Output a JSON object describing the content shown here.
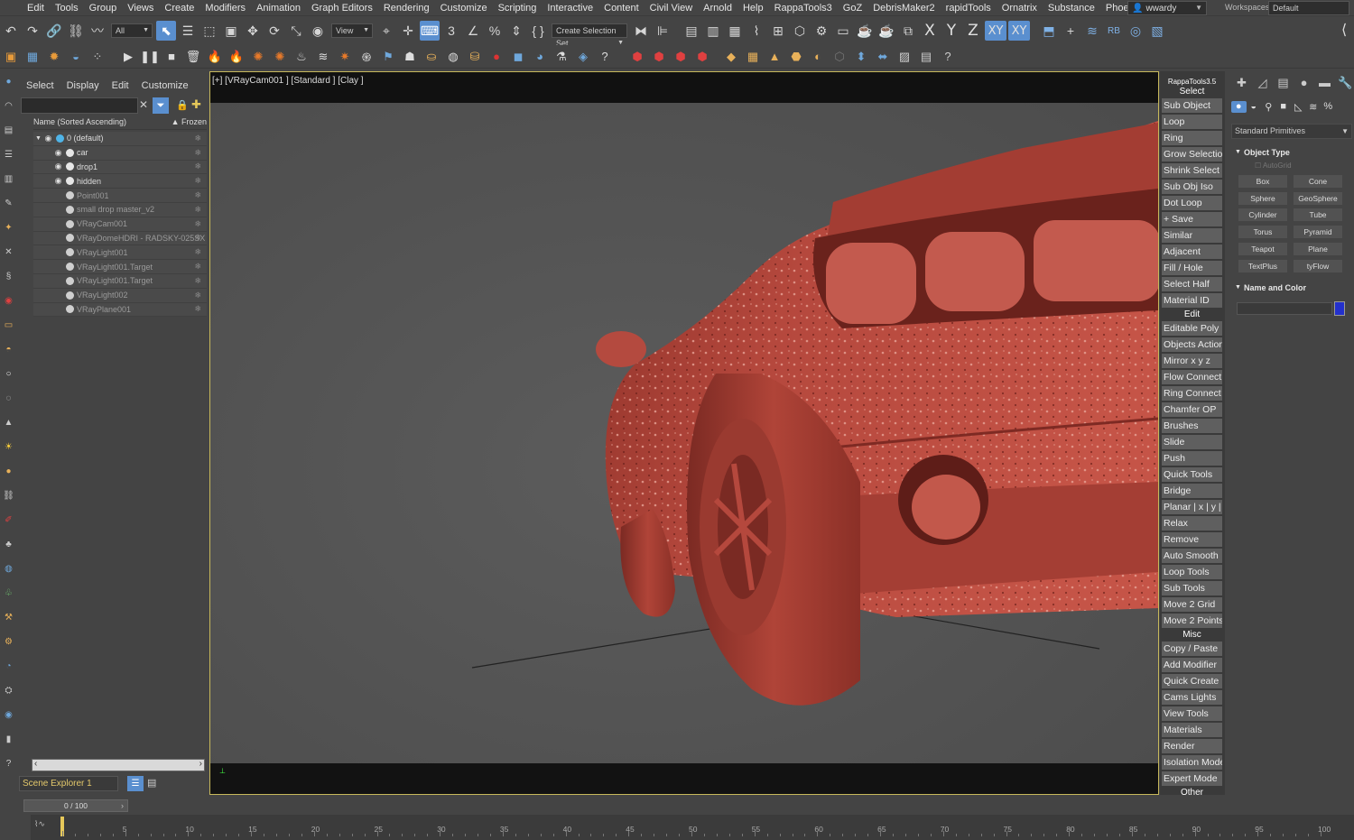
{
  "menu": [
    "Edit",
    "Tools",
    "Group",
    "Views",
    "Create",
    "Modifiers",
    "Animation",
    "Graph Editors",
    "Rendering",
    "Customize",
    "Scripting",
    "Interactive",
    "Content",
    "Civil View",
    "Arnold",
    "Help",
    "RappaTools3",
    "GoZ",
    "DebrisMaker2",
    "rapidTools",
    "Ornatrix",
    "Substance",
    "Phoenix FD"
  ],
  "user": "wwardy",
  "workspaces_label": "Workspaces:",
  "workspace_value": "Default",
  "toolbar": {
    "filter_value": "All",
    "ref_coord_value": "View",
    "selection_set": "Create Selection Set",
    "axis_x": "X",
    "axis_y": "Y",
    "axis_z": "Z",
    "axis_xy": "XY",
    "axis_xy2": "XY"
  },
  "scene_explorer": {
    "menu": [
      "Select",
      "Display",
      "Edit",
      "Customize"
    ],
    "col_name": "Name (Sorted Ascending)",
    "col_frozen": "▲ Frozen",
    "rows": [
      {
        "name": "0 (default)",
        "dim": false
      },
      {
        "name": "car",
        "dim": false
      },
      {
        "name": "drop1",
        "dim": false
      },
      {
        "name": "hidden",
        "dim": false
      },
      {
        "name": "Point001",
        "dim": true
      },
      {
        "name": "small drop master_v2",
        "dim": true
      },
      {
        "name": "VRayCam001",
        "dim": true
      },
      {
        "name": "VRayDomeHDRI - RADSKY-025SX",
        "dim": true
      },
      {
        "name": "VRayLight001",
        "dim": true
      },
      {
        "name": "VRayLight001.Target",
        "dim": true
      },
      {
        "name": "VRayLight001.Target",
        "dim": true
      },
      {
        "name": "VRayLight002",
        "dim": true
      },
      {
        "name": "VRayPlane001",
        "dim": true
      }
    ],
    "explorer_name": "Scene Explorer 1"
  },
  "viewport": {
    "label": "[+] [VRayCam001 ] [Standard ] [Clay ]"
  },
  "rappatools": {
    "title": "RappaTools3.5",
    "items": [
      {
        "label": "Select",
        "head": true
      },
      {
        "label": "Sub Object"
      },
      {
        "label": "Loop"
      },
      {
        "label": "Ring"
      },
      {
        "label": "Grow Selection"
      },
      {
        "label": "Shrink Select"
      },
      {
        "label": "Sub Obj Iso"
      },
      {
        "label": "Dot Loop"
      },
      {
        "label": "+ Save"
      },
      {
        "label": "Similar"
      },
      {
        "label": "Adjacent"
      },
      {
        "label": "Fill / Hole"
      },
      {
        "label": "Select Half"
      },
      {
        "label": "Material ID"
      },
      {
        "label": "Edit",
        "head": true
      },
      {
        "label": "Editable Poly"
      },
      {
        "label": "Objects Actions"
      },
      {
        "label": "Mirror   x  y  z"
      },
      {
        "label": "Flow Connect"
      },
      {
        "label": "Ring Connect"
      },
      {
        "label": "Chamfer OP"
      },
      {
        "label": "Brushes"
      },
      {
        "label": "Slide"
      },
      {
        "label": "Push"
      },
      {
        "label": "Quick Tools"
      },
      {
        "label": "Bridge"
      },
      {
        "label": "Planar | x | y | z"
      },
      {
        "label": "Relax"
      },
      {
        "label": "Remove"
      },
      {
        "label": "Auto Smooth"
      },
      {
        "label": "Loop Tools"
      },
      {
        "label": "Sub Tools"
      },
      {
        "label": "Move 2 Grid"
      },
      {
        "label": "Move 2 Points"
      },
      {
        "label": "Misc",
        "head": true
      },
      {
        "label": "Copy / Paste"
      },
      {
        "label": "Add Modifier"
      },
      {
        "label": "Quick Create"
      },
      {
        "label": "Cams Lights"
      },
      {
        "label": "View Tools"
      },
      {
        "label": "Materials"
      },
      {
        "label": "Render"
      },
      {
        "label": "Isolation Mode"
      },
      {
        "label": "Expert Mode"
      },
      {
        "label": "Other",
        "head": true
      }
    ]
  },
  "command_panel": {
    "primitive_type": "Standard Primitives",
    "object_type_title": "Object Type",
    "autogrid": "AutoGrid",
    "object_buttons": [
      "Box",
      "Cone",
      "Sphere",
      "GeoSphere",
      "Cylinder",
      "Tube",
      "Torus",
      "Pyramid",
      "Teapot",
      "Plane",
      "TextPlus",
      "tyFlow"
    ],
    "name_color_title": "Name and Color",
    "color": "#2330cc"
  },
  "timeline": {
    "slider": "0 / 100",
    "ticks": [
      "5",
      "10",
      "15",
      "20",
      "25",
      "30",
      "35",
      "40",
      "45",
      "50",
      "55",
      "60",
      "65",
      "70",
      "75",
      "80",
      "85",
      "90",
      "95",
      "100"
    ]
  },
  "colors": {
    "accent": "#5a8fcf",
    "viewport_border": "#c7b85b",
    "car": "#b5483d"
  }
}
